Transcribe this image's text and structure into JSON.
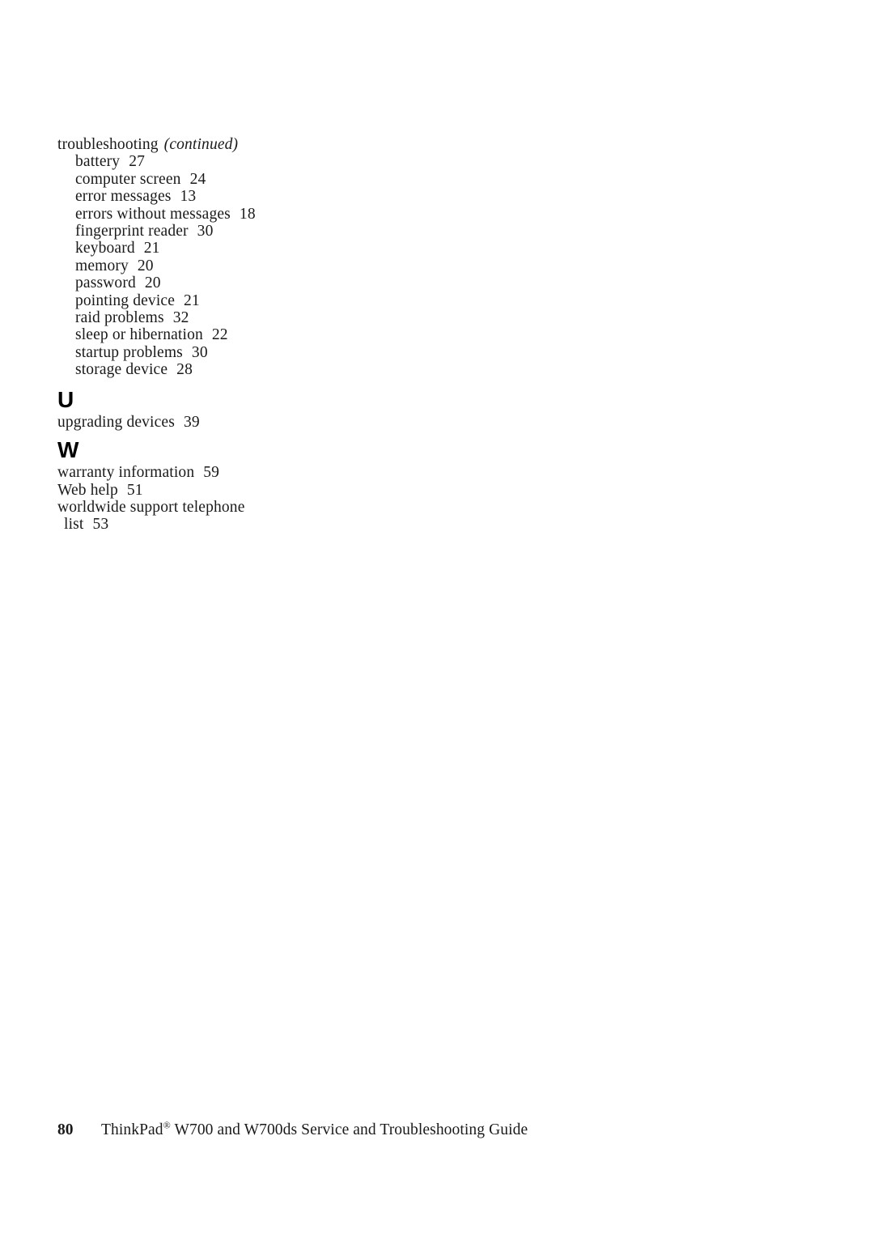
{
  "page": {
    "number": "80",
    "footer_title_before_mark": "ThinkPad",
    "footer_trademark": "®",
    "footer_title_after_mark": " W700 and W700ds Service and Troubleshooting Guide"
  },
  "index": {
    "continued_group": {
      "term": "troubleshooting",
      "continued_label": "(continued)",
      "subentries": [
        {
          "term": "battery",
          "page": "27"
        },
        {
          "term": "computer screen",
          "page": "24"
        },
        {
          "term": "error messages",
          "page": "13"
        },
        {
          "term": "errors without messages",
          "page": "18"
        },
        {
          "term": "fingerprint reader",
          "page": "30"
        },
        {
          "term": "keyboard",
          "page": "21"
        },
        {
          "term": "memory",
          "page": "20"
        },
        {
          "term": "password",
          "page": "20"
        },
        {
          "term": "pointing device",
          "page": "21"
        },
        {
          "term": "raid problems",
          "page": "32"
        },
        {
          "term": "sleep or hibernation",
          "page": "22"
        },
        {
          "term": "startup problems",
          "page": "30"
        },
        {
          "term": "storage device",
          "page": "28"
        }
      ]
    },
    "sections": [
      {
        "letter": "U",
        "entries": [
          {
            "term": "upgrading devices",
            "page": "39",
            "wrap": ""
          }
        ]
      },
      {
        "letter": "W",
        "entries": [
          {
            "term": "warranty information",
            "page": "59",
            "wrap": ""
          },
          {
            "term": "Web help",
            "page": "51",
            "wrap": ""
          },
          {
            "term": "worldwide support telephone",
            "page": "",
            "wrap": ""
          },
          {
            "term": "list",
            "page": "53",
            "wrap": "indent"
          }
        ]
      }
    ]
  }
}
